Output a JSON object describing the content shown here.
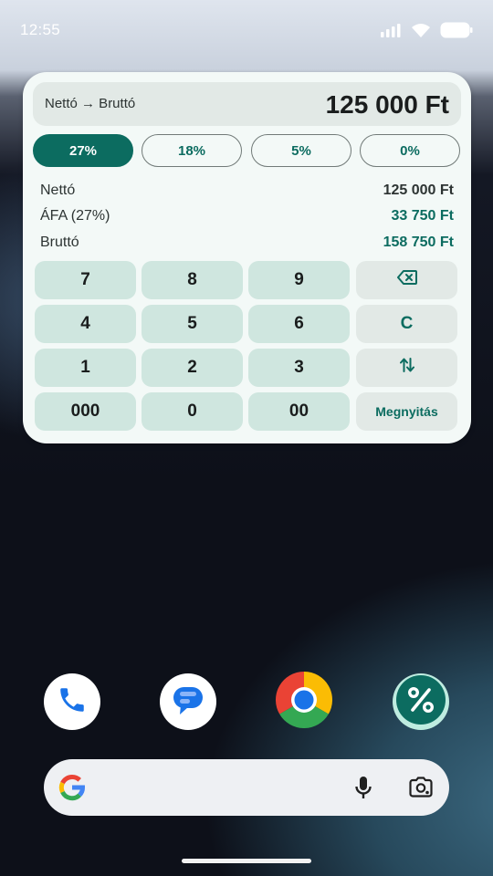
{
  "status_bar": {
    "time": "12:55",
    "icons": [
      "signal-icon",
      "wifi-icon",
      "battery-icon"
    ]
  },
  "widget": {
    "mode_label": "Nettó → Bruttó",
    "display_amount": "125 000 Ft",
    "vat_chips": [
      {
        "label": "27%",
        "selected": true
      },
      {
        "label": "18%",
        "selected": false
      },
      {
        "label": "5%",
        "selected": false
      },
      {
        "label": "0%",
        "selected": false
      }
    ],
    "breakdown": [
      {
        "label": "Nettó",
        "value": "125 000 Ft"
      },
      {
        "label": "ÁFA (27%)",
        "value": "33 750 Ft"
      },
      {
        "label": "Bruttó",
        "value": "158 750 Ft"
      }
    ],
    "keypad": {
      "k7": "7",
      "k8": "8",
      "k9": "9",
      "k4": "4",
      "k5": "5",
      "k6": "6",
      "k1": "1",
      "k2": "2",
      "k3": "3",
      "k000": "000",
      "k0": "0",
      "k00": "00",
      "backspace_icon": "backspace-icon",
      "clear": "C",
      "swap_icon": "swap-vertical-icon",
      "open": "Megnyitás"
    }
  },
  "dock": {
    "apps": [
      "phone-icon",
      "messages-icon",
      "chrome-icon",
      "percent-app-icon"
    ]
  },
  "search_bar": {
    "icons": [
      "google-logo-icon",
      "microphone-icon",
      "lens-camera-icon"
    ]
  },
  "colors": {
    "accent": "#0c6c60",
    "key_bg": "#cfe6df",
    "function_key_bg": "#e2e9e6",
    "widget_bg": "#f3f9f7"
  }
}
